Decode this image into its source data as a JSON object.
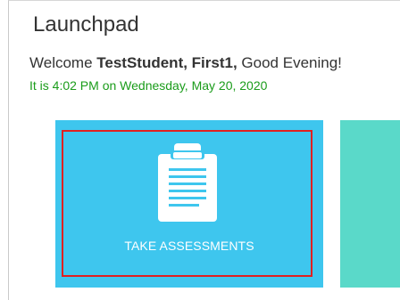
{
  "header": {
    "title": "Launchpad",
    "welcome_prefix": "Welcome ",
    "user_name": "TestStudent, First1,",
    "welcome_suffix": " Good Evening!",
    "datetime_text": "It is 4:02 PM on Wednesday, May 20, 2020"
  },
  "tiles": [
    {
      "label": "TAKE ASSESSMENTS",
      "icon": "clipboard-icon",
      "color": "#3ec6ee",
      "selected": true
    },
    {
      "label": "",
      "color": "#5ad9c9"
    }
  ],
  "colors": {
    "datetime_text": "#1a9c1a",
    "selection_outline": "#e02020"
  }
}
